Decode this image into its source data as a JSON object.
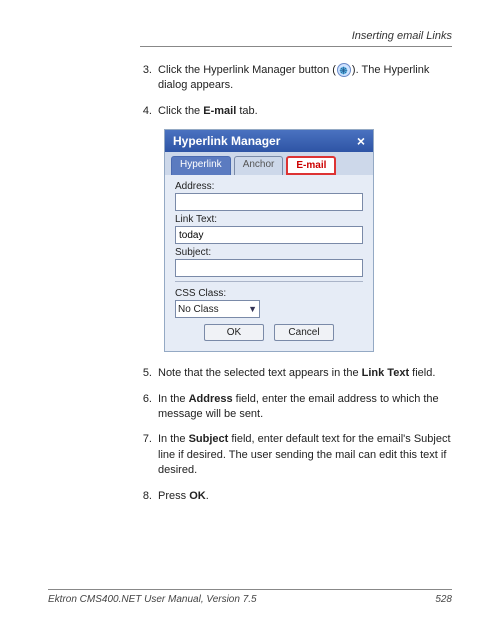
{
  "header": {
    "title": "Inserting email Links"
  },
  "steps": {
    "s3": {
      "num": "3.",
      "prefix": "Click the Hyperlink Manager button (",
      "suffix": "). The Hyperlink dialog appears."
    },
    "s4": {
      "num": "4.",
      "prefix": "Click the ",
      "bold": "E-mail",
      "suffix": " tab."
    },
    "s5": {
      "num": "5.",
      "prefix": "Note that the selected text appears in the ",
      "bold": "Link Text",
      "suffix": " field."
    },
    "s6": {
      "num": "6.",
      "prefix": "In the ",
      "bold": "Address",
      "suffix": " field, enter the email address to which the message will be sent."
    },
    "s7": {
      "num": "7.",
      "prefix": "In the ",
      "bold": "Subject",
      "suffix": " field, enter default text for the email's Subject line if desired. The user sending the mail can edit this text if desired."
    },
    "s8": {
      "num": "8.",
      "prefix": "Press ",
      "bold": "OK",
      "suffix": "."
    }
  },
  "dialog": {
    "title": "Hyperlink Manager",
    "tabs": {
      "hyperlink": "Hyperlink",
      "anchor": "Anchor",
      "email": "E-mail"
    },
    "labels": {
      "address": "Address:",
      "linktext": "Link Text:",
      "subject": "Subject:",
      "cssclass": "CSS Class:"
    },
    "values": {
      "address": "",
      "linktext": "today",
      "subject": "",
      "cssclass": "No Class"
    },
    "buttons": {
      "ok": "OK",
      "cancel": "Cancel"
    }
  },
  "footer": {
    "manual": "Ektron CMS400.NET User Manual, Version 7.5",
    "page": "528"
  }
}
